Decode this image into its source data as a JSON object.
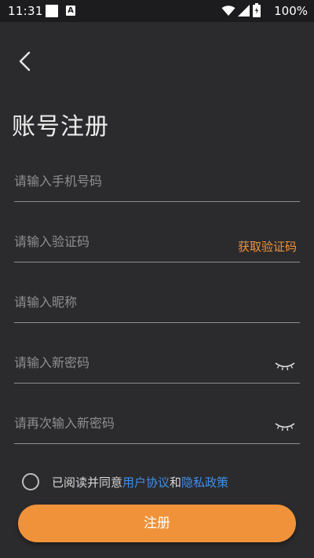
{
  "status_bar": {
    "time": "11:31",
    "battery": "100%"
  },
  "page": {
    "title": "账号注册"
  },
  "form": {
    "phone_placeholder": "请输入手机号码",
    "code_placeholder": "请输入验证码",
    "get_code_label": "获取验证码",
    "nickname_placeholder": "请输入昵称",
    "password_placeholder": "请输入新密码",
    "confirm_password_placeholder": "请再次输入新密码"
  },
  "agreement": {
    "prefix": "已阅读并同意",
    "user_agreement": "用户协议",
    "and": "和",
    "privacy_policy": "隐私政策",
    "checked": false
  },
  "submit": {
    "label": "注册"
  },
  "colors": {
    "accent": "#f0923a",
    "link": "#3f8fe8",
    "background": "#2b2b2d"
  },
  "icons": {
    "back": "back-arrow-icon",
    "password_toggle": "eye-closed-icon"
  }
}
